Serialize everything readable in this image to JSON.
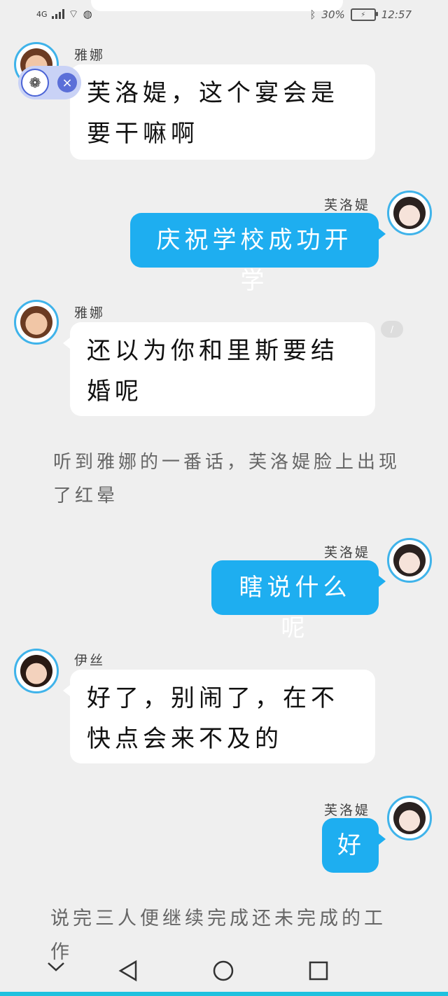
{
  "status_bar": {
    "network": "4G",
    "battery": "30%",
    "time": "12:57",
    "icons": [
      "signal-icon",
      "wifi-icon",
      "vpn-icon",
      "bluetooth-icon",
      "battery-icon"
    ]
  },
  "messages": [
    {
      "speaker": "雅娜",
      "side": "left",
      "text": "芙洛媞，这个宴会是要干嘛啊"
    },
    {
      "speaker": "芙洛媞",
      "side": "right",
      "text": "庆祝学校成功开学"
    },
    {
      "speaker": "雅娜",
      "side": "left",
      "text": "还以为你和里斯要结婚呢"
    },
    {
      "speaker": "芙洛媞",
      "side": "right",
      "text": "瞎说什么呢"
    },
    {
      "speaker": "伊丝",
      "side": "left",
      "text": "好了，别闹了，在不快点会来不及的"
    },
    {
      "speaker": "芙洛媞",
      "side": "right",
      "text": "好"
    }
  ],
  "narration": [
    "听到雅娜的一番话，芙洛媞脸上出现了红晕",
    "说完三人便继续完成还未完成的工作"
  ],
  "floating_widget": {
    "icon": "paw-icon",
    "close": "×"
  },
  "navbar": {
    "buttons": [
      "chevron-down-icon",
      "back-icon",
      "home-icon",
      "recents-icon"
    ]
  },
  "colors": {
    "background": "#efefef",
    "left_bubble": "#ffffff",
    "right_bubble": "#1eaef0",
    "avatar_ring": "#3fb3ea",
    "bottom_line": "#20c1df"
  }
}
